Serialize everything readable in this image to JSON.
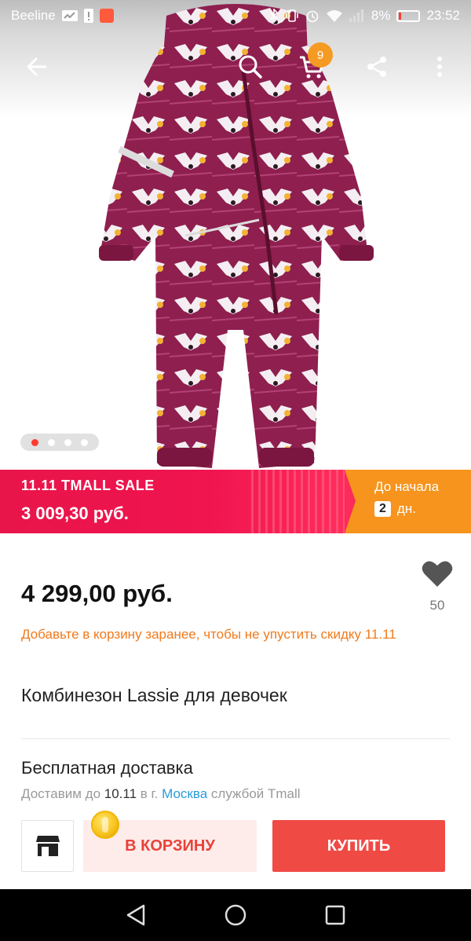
{
  "status_bar": {
    "carrier": "Beeline",
    "battery_percent": "8%",
    "time": "23:52"
  },
  "top_bar": {
    "cart_count": "9",
    "icons": [
      "back-arrow-icon",
      "search-icon",
      "cart-icon",
      "share-icon",
      "more-vert-icon"
    ]
  },
  "gallery": {
    "total_images": 4,
    "active_index": 0
  },
  "sale_banner": {
    "title": "11.11 TMALL SALE",
    "sale_price": "3 009,30 руб.",
    "countdown_label": "До начала",
    "countdown_value": "2",
    "countdown_unit": "дн."
  },
  "product": {
    "price": "4 299,00 руб.",
    "favorites_count": "50",
    "promo_note": "Добавьте в корзину заранее, чтобы не упустить скидку 11.11",
    "title": "Комбинезон Lassie для девочек"
  },
  "delivery": {
    "title": "Бесплатная доставка",
    "prefix": "Доставим до",
    "date": "10.11",
    "city_prefix": "в г.",
    "city": "Москва",
    "suffix": "службой Tmall"
  },
  "actions": {
    "add_to_cart": "В КОРЗИНУ",
    "buy": "КУПИТЬ"
  },
  "colors": {
    "sale_pink": "#e8154a",
    "countdown_orange": "#f7941d",
    "buy_red": "#f04a45",
    "promo_orange": "#f07a1c",
    "link_blue": "#2a9bd8"
  }
}
